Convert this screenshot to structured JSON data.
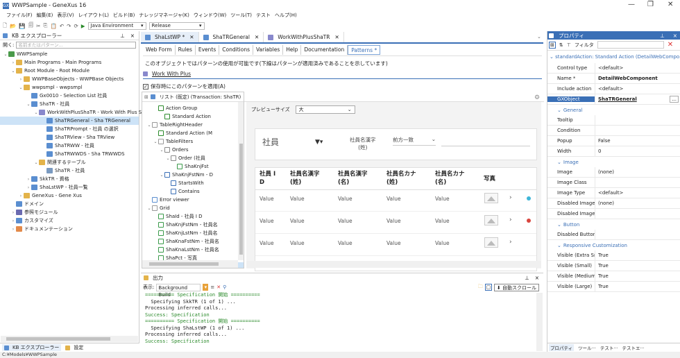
{
  "window": {
    "title": "WWPSample - GeneXus 16",
    "minimize": "—",
    "restore": "❐",
    "close": "✕"
  },
  "menu": [
    "ファイル(F)",
    "編集(E)",
    "表示(V)",
    "レイアウト(L)",
    "ビルド(B)",
    "ナレッジマネージャ(K)",
    "ウィンドウ(W)",
    "ツール(T)",
    "テスト",
    "ヘルプ(H)"
  ],
  "toolbar": {
    "environment": "Java Environment",
    "config": "Release"
  },
  "kb": {
    "title": "KB エクスプローラー",
    "search_label": "開く:",
    "search_placeholder": "名前またはパターン...",
    "pin": "ꟷ",
    "close": "×",
    "tree": [
      {
        "label": "WWPSample",
        "indent": 0,
        "arrow": "⌄",
        "color": "#4a9a4a"
      },
      {
        "label": "Main Programs - Main Programs",
        "indent": 1,
        "arrow": "›",
        "color": "#e3b34a"
      },
      {
        "label": "Root Module - Root Module",
        "indent": 1,
        "arrow": "⌄",
        "color": "#e3b34a"
      },
      {
        "label": "WWPBaseObjects - WWPBase Objects",
        "indent": 2,
        "arrow": "›",
        "color": "#e3b34a"
      },
      {
        "label": "wwpsmpl - wwpsmpl",
        "indent": 2,
        "arrow": "⌄",
        "color": "#e3b34a"
      },
      {
        "label": "Gx0010 - Selection List 社員",
        "indent": 3,
        "arrow": "",
        "color": "#5a8ed0"
      },
      {
        "label": "ShaTR - 社員",
        "indent": 3,
        "arrow": "⌄",
        "color": "#5a8ed0"
      },
      {
        "label": "WorkWithPlusShaTR - Work With Plus S",
        "indent": 4,
        "arrow": "⌄",
        "color": "#8888cc"
      },
      {
        "label": "ShaTRGeneral - Sha TRGeneral",
        "indent": 5,
        "arrow": "",
        "color": "#5a8ed0",
        "selected": true
      },
      {
        "label": "ShaTRPrompt - 社員 の選択",
        "indent": 5,
        "arrow": "",
        "color": "#5a8ed0"
      },
      {
        "label": "ShaTRView - Sha TRView",
        "indent": 5,
        "arrow": "",
        "color": "#5a8ed0"
      },
      {
        "label": "ShaTRWW - 社員",
        "indent": 5,
        "arrow": "",
        "color": "#5a8ed0"
      },
      {
        "label": "ShaTRWWDS - Sha TRWWDS",
        "indent": 5,
        "arrow": "",
        "color": "#5a8ed0"
      },
      {
        "label": "関連するテーブル",
        "indent": 4,
        "arrow": "⌄",
        "color": "#e3b34a"
      },
      {
        "label": "ShaTR - 社員",
        "indent": 5,
        "arrow": "",
        "color": "#7a9ac0"
      },
      {
        "label": "SkkTR - 資格",
        "indent": 3,
        "arrow": "›",
        "color": "#5a8ed0"
      },
      {
        "label": "ShaLstWP - 社員一覧",
        "indent": 3,
        "arrow": "›",
        "color": "#5a8ed0"
      },
      {
        "label": "GeneXus - Gene Xus",
        "indent": 2,
        "arrow": "›",
        "color": "#e3b34a"
      },
      {
        "label": "ドメイン",
        "indent": 1,
        "arrow": "",
        "color": "#5a8ed0"
      },
      {
        "label": "参照モジュール",
        "indent": 1,
        "arrow": "›",
        "color": "#6a6ab0"
      },
      {
        "label": "カスタマイズ",
        "indent": 1,
        "arrow": "›",
        "color": "#5a8ed0"
      },
      {
        "label": "ドキュメンテーション",
        "indent": 1,
        "arrow": "›",
        "color": "#e38a4a"
      }
    ],
    "tabs": [
      "KB エクスプローラー",
      "設定"
    ]
  },
  "doc": {
    "tabs": [
      {
        "label": "ShaLstWP *",
        "color": "#5a8ed0"
      },
      {
        "label": "ShaTRGeneral",
        "color": "#5a8ed0"
      },
      {
        "label": "WorkWithPlusShaTR",
        "color": "#8888cc"
      }
    ],
    "subtabs": [
      "Web Form",
      "Rules",
      "Events",
      "Conditions",
      "Variables",
      "Help",
      "Documentation",
      "Patterns *"
    ],
    "notice": "このオブジェクトではパターンの使用が可能です(下線はパターンが適用済みであることを示しています)",
    "wwp_link": "Work With Plus",
    "save_apply": "保存時にこのパターンを適用(A)",
    "tree_header": "リスト (既定) (Transaction: ShaTR)",
    "pattern_tree": [
      {
        "label": "Action Group",
        "indent": 3,
        "icon": "flag"
      },
      {
        "label": "Standard Action",
        "indent": 4,
        "icon": "flag"
      },
      {
        "label": "TableRightHeader",
        "indent": 2,
        "icon": "table",
        "arrow": "⌄"
      },
      {
        "label": "Standard Action (M",
        "indent": 3,
        "icon": "flag"
      },
      {
        "label": "TableFilters",
        "indent": 3,
        "icon": "table",
        "arrow": "⌄"
      },
      {
        "label": "Orders",
        "indent": 4,
        "icon": "orders",
        "arrow": "⌄"
      },
      {
        "label": "Order (社員",
        "indent": 5,
        "icon": "order",
        "arrow": "⌄"
      },
      {
        "label": "ShaKnjFst",
        "indent": 6,
        "icon": "attr"
      },
      {
        "label": "ShaKnjFstNm - D",
        "indent": 4,
        "icon": "filter",
        "arrow": "⌄"
      },
      {
        "label": "StartsWith",
        "indent": 5,
        "icon": "filter"
      },
      {
        "label": "Contains",
        "indent": 5,
        "icon": "filter"
      },
      {
        "label": "Error viewer",
        "indent": 2,
        "icon": "err"
      },
      {
        "label": "Grid",
        "indent": 2,
        "icon": "table",
        "arrow": "⌄"
      },
      {
        "label": "ShaId - 社員 I D",
        "indent": 3,
        "icon": "attr"
      },
      {
        "label": "ShaKnjFstNm - 社員名",
        "indent": 3,
        "icon": "attr"
      },
      {
        "label": "ShaKnjLstNm - 社員名",
        "indent": 3,
        "icon": "attr"
      },
      {
        "label": "ShaKnaFstNm - 社員名",
        "indent": 3,
        "icon": "attr"
      },
      {
        "label": "ShaKnaLstNm - 社員名",
        "indent": 3,
        "icon": "attr"
      },
      {
        "label": "ShaPct - 写真",
        "indent": 3,
        "icon": "attr"
      },
      {
        "label": "Standard Action (Detail",
        "indent": 3,
        "icon": "flag",
        "selected": true
      }
    ]
  },
  "preview": {
    "size_label": "プレビューサイズ",
    "size_value": "大",
    "filter_title": "社員",
    "filter_field": "社員名漢字\n(姓)",
    "filter_op": "前方一致",
    "columns": [
      "社員 I\nD",
      "社員名漢字\n(姓)",
      "社員名漢字\n(名)",
      "社員名カナ\n(姓)",
      "社員名カナ\n(名)",
      "写真"
    ],
    "rows": [
      [
        "Value",
        "Value",
        "Value",
        "Value",
        "Value"
      ],
      [
        "Value",
        "Value",
        "Value",
        "Value",
        "Value"
      ],
      [
        "Value",
        "Value",
        "Value",
        "Value",
        "Value"
      ]
    ],
    "dots": [
      "#3fb6d8",
      "#d9463f"
    ]
  },
  "output": {
    "title": "出力",
    "show_label": "表示:",
    "source": "Background Build",
    "autoscroll": "自動スクロール",
    "lines": [
      {
        "text": "========== Specification 開始 ==========",
        "green": true
      },
      {
        "text": "  Specifying SkkTR (1 of 1) ...",
        "green": false
      },
      {
        "text": "Processing inferred calls...",
        "green": false
      },
      {
        "text": "Success: Specification",
        "green": true
      },
      {
        "text": "========== Specification 開始 ==========",
        "green": true
      },
      {
        "text": "  Specifying ShaLstWP (1 of 1) ...",
        "green": false
      },
      {
        "text": "Processing inferred calls...",
        "green": false
      },
      {
        "text": "Success: Specification",
        "green": true
      }
    ]
  },
  "props": {
    "title": "プロパティ",
    "filter_label": "フィルタ",
    "subject": "standardAction: Standard Action (DetailWebCompo...",
    "rows": [
      {
        "type": "row",
        "k": "Control type",
        "v": "<default>"
      },
      {
        "type": "row",
        "k": "Name *",
        "v": "DetailWebComponent",
        "bold": true
      },
      {
        "type": "row",
        "k": "Include action",
        "v": "<default>"
      },
      {
        "type": "row",
        "k": "GXObject",
        "v": "ShaTRGeneral",
        "selected": true,
        "btn": "..."
      },
      {
        "type": "cat",
        "k": "General"
      },
      {
        "type": "row",
        "k": "Tooltip",
        "v": ""
      },
      {
        "type": "row",
        "k": "Condition",
        "v": ""
      },
      {
        "type": "row",
        "k": "Popup",
        "v": "False"
      },
      {
        "type": "row",
        "k": "Width",
        "v": "0"
      },
      {
        "type": "cat",
        "k": "Image"
      },
      {
        "type": "row",
        "k": "Image",
        "v": "(none)"
      },
      {
        "type": "row",
        "k": "Image Class",
        "v": ""
      },
      {
        "type": "row",
        "k": "Image Type",
        "v": "<default>"
      },
      {
        "type": "row",
        "k": "Disabled Image",
        "v": "(none)"
      },
      {
        "type": "row",
        "k": "Disabled Image Cl",
        "v": ""
      },
      {
        "type": "cat",
        "k": "Button"
      },
      {
        "type": "row",
        "k": "Disabled Button C",
        "v": ""
      },
      {
        "type": "cat",
        "k": "Responsive Customization"
      },
      {
        "type": "row",
        "k": "Visible (Extra Sma",
        "v": "True"
      },
      {
        "type": "row",
        "k": "Visible (Small)",
        "v": "True"
      },
      {
        "type": "row",
        "k": "Visible (Medium)",
        "v": "True"
      },
      {
        "type": "row",
        "k": "Visible (Large)",
        "v": "True"
      }
    ],
    "tabs": [
      "プロパティ",
      "ツール···",
      "テスト···",
      "テストエ···"
    ]
  },
  "status": "C:¥Models¥WWPSample"
}
